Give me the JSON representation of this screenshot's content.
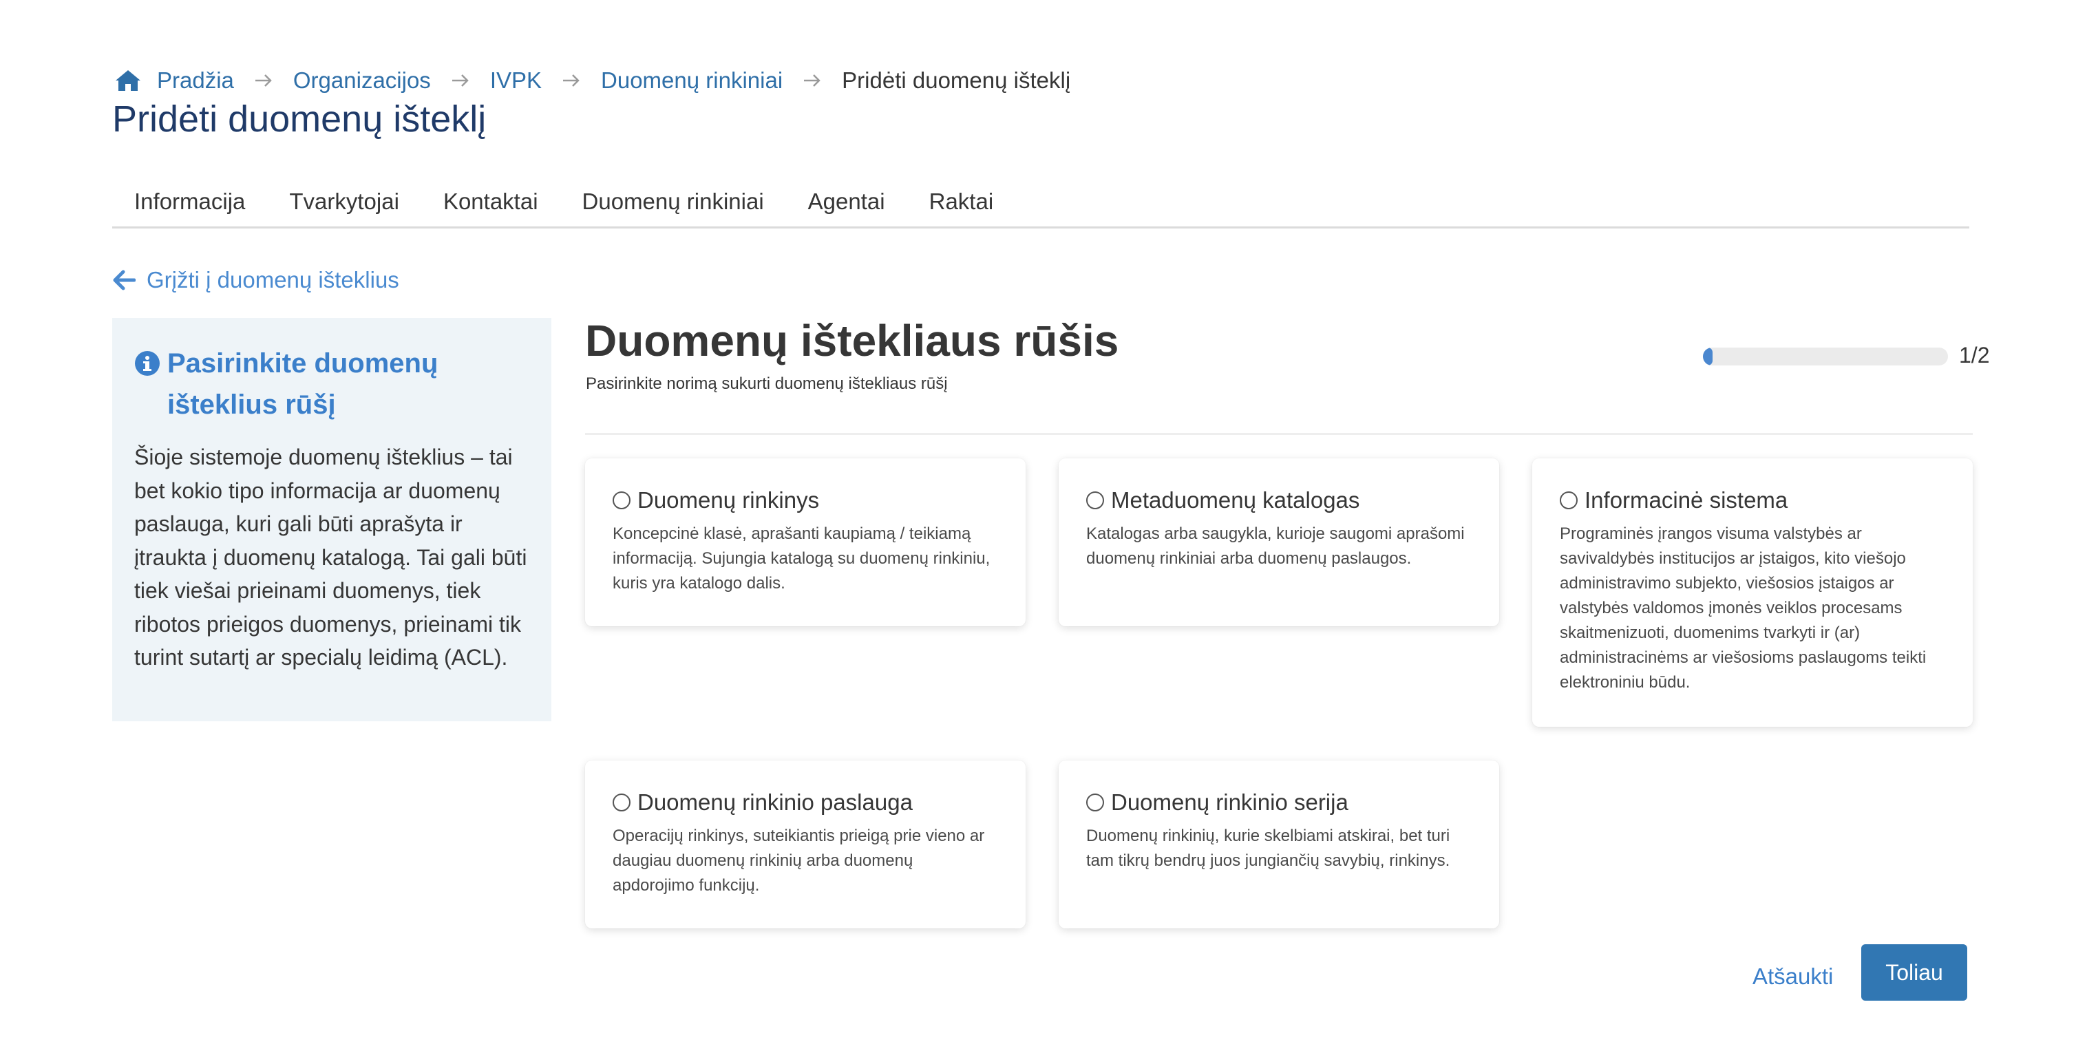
{
  "breadcrumb": {
    "home": "Pradžia",
    "items": [
      "Organizacijos",
      "IVPK",
      "Duomenų rinkiniai"
    ],
    "current": "Pridėti duomenų išteklį"
  },
  "page_title": "Pridėti duomenų išteklį",
  "tabs": [
    "Informacija",
    "Tvarkytojai",
    "Kontaktai",
    "Duomenų rinkiniai",
    "Agentai",
    "Raktai"
  ],
  "back_link": "Grįžti į duomenų išteklius",
  "side_panel": {
    "title": "Pasirinkite duomenų išteklius rūšį",
    "text": "Šioje sistemoje duomenų išteklius – tai bet kokio tipo informacija ar duomenų paslauga, kuri gali būti aprašyta ir įtraukta į duomenų katalogą. Tai gali būti tiek viešai prieinami duomenys, tiek ribotos prieigos duomenys, prieinami tik turint sutartį ar specialų leidimą (ACL)."
  },
  "main": {
    "title": "Duomenų ištekliaus rūšis",
    "subtitle": "Pasirinkite norimą sukurti duomenų ištekliaus rūšį"
  },
  "progress": {
    "label": "1/2",
    "fraction": 0.04
  },
  "options": [
    {
      "title": "Duomenų rinkinys",
      "desc": "Koncepcinė klasė, aprašanti kaupiamą / teikiamą informaciją. Sujungia katalogą su duomenų rinkiniu, kuris yra katalogo dalis."
    },
    {
      "title": "Metaduomenų katalogas",
      "desc": "Katalogas arba saugykla, kurioje saugomi aprašomi duomenų rinkiniai arba duomenų paslaugos."
    },
    {
      "title": "Informacinė sistema",
      "desc": "Programinės įrangos visuma valstybės ar savivaldybės institucijos ar įstaigos, kito viešojo administravimo subjekto, viešosios įstaigos ar valstybės valdomos įmonės veiklos procesams skaitmenizuoti, duomenims tvarkyti ir (ar) administracinėms ar viešosioms paslaugoms teikti elektroniniu būdu."
    },
    {
      "title": "Duomenų rinkinio paslauga",
      "desc": "Operacijų rinkinys, suteikiantis prieigą prie vieno ar daugiau duomenų rinkinių arba duomenų apdorojimo funkcijų."
    },
    {
      "title": "Duomenų rinkinio serija",
      "desc": "Duomenų rinkinių, kurie skelbiami atskirai, bet turi tam tikrų bendrų juos jungiančių savybių, rinkinys."
    }
  ],
  "buttons": {
    "cancel": "Atšaukti",
    "next": "Toliau"
  },
  "colors": {
    "accent": "#3177b3",
    "link": "#2f6fa8",
    "title": "#1f3a68",
    "panel_bg": "#eef4f8"
  }
}
